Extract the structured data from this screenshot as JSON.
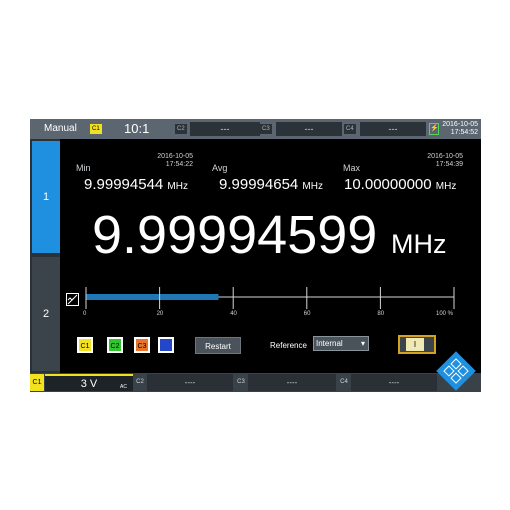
{
  "top_bar": {
    "mode": "Manual",
    "c1_tag": "C1",
    "probe_ratio": "10:1",
    "c2_tag": "C2",
    "c2_value": "---",
    "c3_tag": "C3",
    "c3_value": "---",
    "c4_tag": "C4",
    "c4_value": "---",
    "date": "2016-10-05",
    "time": "17:54:52"
  },
  "sidebar": {
    "items": [
      {
        "label": "1",
        "active": true
      },
      {
        "label": "2",
        "active": false
      }
    ]
  },
  "stats": {
    "min": {
      "label": "Min",
      "date": "2016-10-05",
      "time": "17:54:22",
      "value": "9.99994544",
      "unit": "MHz"
    },
    "avg": {
      "label": "Avg",
      "value": "9.99994654",
      "unit": "MHz"
    },
    "max": {
      "label": "Max",
      "date": "2016-10-05",
      "time": "17:54:39",
      "value": "10.00000000",
      "unit": "MHz"
    }
  },
  "readout": {
    "value": "9.99994599",
    "unit": "MHz"
  },
  "scale": {
    "ticks": [
      "0",
      "20",
      "40",
      "60",
      "80",
      "100 %"
    ],
    "fill_percent": 36
  },
  "controls": {
    "channel_buttons": [
      {
        "label": "C1",
        "color": "#f2e11e",
        "text_color": "#000000"
      },
      {
        "label": "C2",
        "color": "#2fc52f",
        "text_color": "#000000"
      },
      {
        "label": "C3",
        "color": "#e8742b",
        "text_color": "#000000"
      },
      {
        "label": "",
        "color": "#2446c9",
        "text_color": "#ffffff"
      }
    ],
    "restart_label": "Restart",
    "reference_label": "Reference",
    "reference_value": "Internal",
    "toggle_value": "I"
  },
  "bottom_bar": {
    "c1_tag": "C1",
    "c1_value": "3 V",
    "c1_coupling": "AC",
    "c2_tag": "C2",
    "c2_value": "----",
    "c3_tag": "C3",
    "c3_value": "----",
    "c4_tag": "C4",
    "c4_value": "----"
  },
  "colors": {
    "accent": "#1f8fe0",
    "c1": "#f2e11e",
    "scale_fill": "#1f77b4",
    "toggle_border": "#d6a320"
  }
}
